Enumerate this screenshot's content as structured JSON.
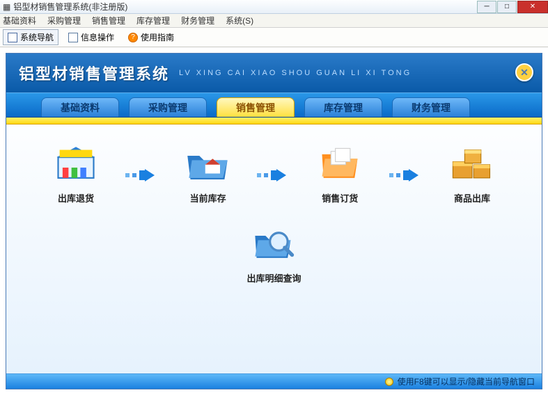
{
  "window": {
    "title": "铝型材销售管理系统(非注册版)"
  },
  "menu": {
    "basic": "基础资料",
    "purchase": "采购管理",
    "sales": "销售管理",
    "stock": "库存管理",
    "finance": "财务管理",
    "system": "系统(S)"
  },
  "toolbar": {
    "nav": "系统导航",
    "info": "信息操作",
    "guide": "使用指南"
  },
  "header": {
    "title": "铝型材销售管理系统",
    "subtitle": "LV XING CAI XIAO SHOU GUAN LI XI TONG"
  },
  "tabs": {
    "basic": "基础资料",
    "purchase": "采购管理",
    "sales": "销售管理",
    "stock": "库存管理",
    "finance": "财务管理"
  },
  "items": {
    "return": "出库退货",
    "current": "当前库存",
    "order": "销售订货",
    "out": "商品出库",
    "query": "出库明细查询"
  },
  "footer": {
    "hint": "使用F8键可以显示/隐藏当前导航窗口"
  }
}
